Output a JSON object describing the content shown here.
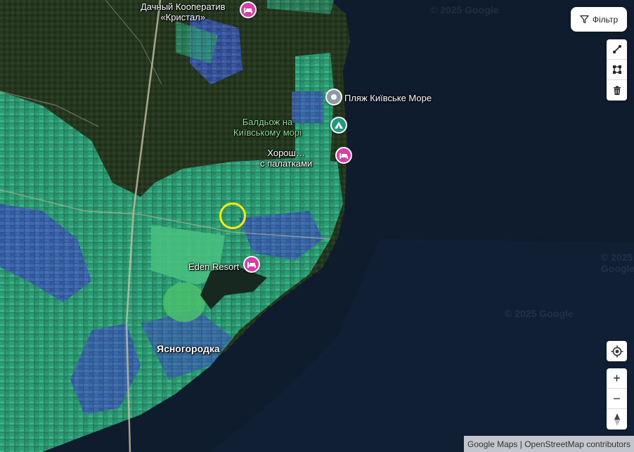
{
  "map": {
    "places": [
      {
        "name": "Дачный Кооператив «Кристал»",
        "line1": "Дачный Кооператив",
        "line2": "«Кристал»"
      },
      {
        "name": "Пляж Київське Море"
      },
      {
        "name": "Балдьож на Київському морі",
        "line1": "Балдьож на",
        "line2": "Київському морі"
      },
      {
        "name": "Хороше з палатками",
        "line1": "Хорош…",
        "line2": "с палатками"
      },
      {
        "name": "Eden Resort"
      },
      {
        "name": "Ясногородка"
      }
    ],
    "watermarks": [
      "© 2025 Google",
      "© 2025 Google",
      "© 2025 Google"
    ],
    "pin_icons": [
      "hotel-icon",
      "location-icon",
      "campground-icon",
      "hotel-icon",
      "hotel-icon"
    ],
    "colors": {
      "water": "#0f1c2e",
      "parcel_green": "#2fae7e",
      "parcel_blue": "#3b55b0",
      "marker": "#ffeb00",
      "pin_hotel": "#d63fa7",
      "pin_campground": "#1f9a7a",
      "pin_location": "#8d9aa3"
    }
  },
  "controls": {
    "filter_label": "Фільтр",
    "draw_tools": [
      "draw-line-icon",
      "draw-polygon-icon",
      "trash-icon"
    ],
    "locate": "crosshair-icon",
    "zoom_in": "+",
    "zoom_out": "−",
    "compass": "compass-icon"
  },
  "attribution": {
    "text": "Google Maps | OpenStreetMap contributors"
  }
}
